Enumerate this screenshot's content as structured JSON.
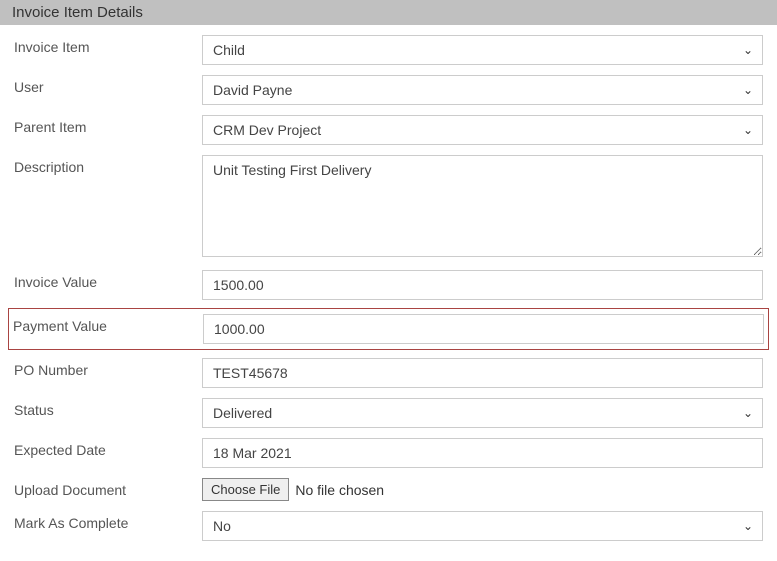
{
  "section_title": "Invoice Item Details",
  "labels": {
    "invoice_item": "Invoice Item",
    "user": "User",
    "parent_item": "Parent Item",
    "description": "Description",
    "invoice_value": "Invoice Value",
    "payment_value": "Payment Value",
    "po_number": "PO Number",
    "status": "Status",
    "expected_date": "Expected Date",
    "upload_document": "Upload Document",
    "mark_as_complete": "Mark As Complete"
  },
  "values": {
    "invoice_item": "Child",
    "user": "David Payne",
    "parent_item": "CRM Dev Project",
    "description": "Unit Testing First Delivery",
    "invoice_value": "1500.00",
    "payment_value": "1000.00",
    "po_number": "TEST45678",
    "status": "Delivered",
    "expected_date": "18 Mar 2021",
    "mark_as_complete": "No"
  },
  "file": {
    "button_label": "Choose File",
    "status": "No file chosen"
  }
}
